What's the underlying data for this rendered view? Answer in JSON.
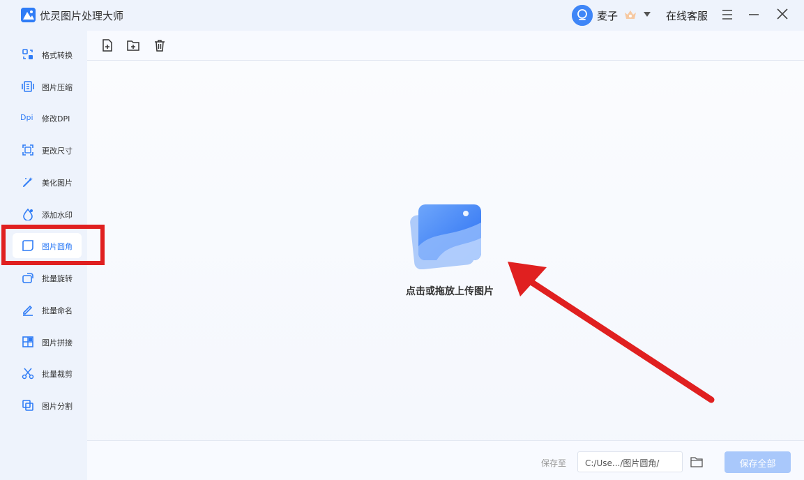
{
  "app": {
    "title": "优灵图片处理大师"
  },
  "header": {
    "username": "麦子",
    "service": "在线客服"
  },
  "sidebar": {
    "items": [
      {
        "label": "格式转换",
        "icon": "format-convert-icon"
      },
      {
        "label": "图片压缩",
        "icon": "compress-icon"
      },
      {
        "label": "修改DPI",
        "icon": "dpi-icon",
        "icon_text": "Dpi"
      },
      {
        "label": "更改尺寸",
        "icon": "resize-icon"
      },
      {
        "label": "美化图片",
        "icon": "magic-wand-icon"
      },
      {
        "label": "添加水印",
        "icon": "watermark-icon"
      },
      {
        "label": "图片圆角",
        "icon": "rounded-corner-icon",
        "active": true
      },
      {
        "label": "批量旋转",
        "icon": "rotate-icon"
      },
      {
        "label": "批量命名",
        "icon": "rename-icon"
      },
      {
        "label": "图片拼接",
        "icon": "collage-icon"
      },
      {
        "label": "批量裁剪",
        "icon": "scissors-icon"
      },
      {
        "label": "图片分割",
        "icon": "split-icon"
      }
    ]
  },
  "toolbar": {
    "buttons": [
      "add-file-icon",
      "add-folder-icon",
      "trash-icon"
    ]
  },
  "upload": {
    "text": "点击或拖放上传图片"
  },
  "footer": {
    "save_to_label": "保存至",
    "path": "C:/Use.../图片圆角/",
    "save_all": "保存全部"
  },
  "colors": {
    "accent": "#2f7cf6",
    "annotation_red": "#e02020",
    "save_button_disabled": "#a9c8fb"
  }
}
